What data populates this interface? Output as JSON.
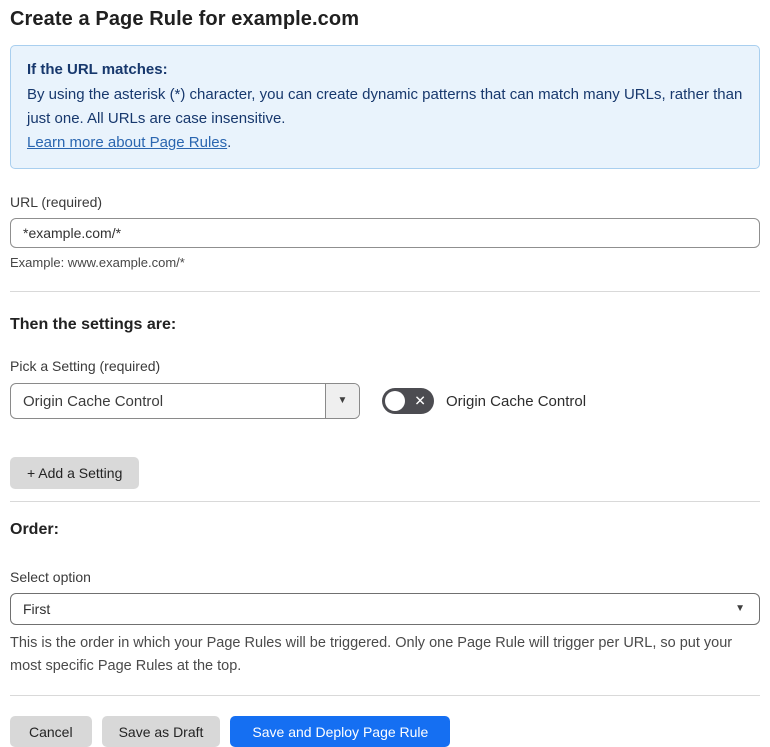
{
  "page": {
    "title": "Create a Page Rule for example.com"
  },
  "info_box": {
    "heading": "If the URL matches:",
    "body": "By using the asterisk (*) character, you can create dynamic patterns that can match many URLs, rather than just one. All URLs are case insensitive.",
    "link_text": "Learn more about Page Rules",
    "link_suffix": "."
  },
  "url_field": {
    "label": "URL (required)",
    "value": "*example.com/*",
    "example": "Example: www.example.com/*"
  },
  "settings_section": {
    "heading": "Then the settings are:",
    "pick_label": "Pick a Setting (required)",
    "selected_setting": "Origin Cache Control",
    "dropdown_arrow": "▼",
    "toggle_state": "off",
    "toggle_off_glyph": "✕",
    "toggle_label": "Origin Cache Control",
    "add_button_label": "+ Add a Setting"
  },
  "order_section": {
    "heading": "Order:",
    "select_label": "Select option",
    "selected_option": "First",
    "dropdown_arrow": "▼",
    "help_text": "This is the order in which your Page Rules will be triggered. Only one Page Rule will trigger per URL, so put your most specific Page Rules at the top."
  },
  "footer": {
    "cancel_label": "Cancel",
    "save_draft_label": "Save as Draft",
    "save_deploy_label": "Save and Deploy Page Rule"
  },
  "colors": {
    "info_background": "#e9f3fc",
    "info_border": "#a9cfef",
    "info_text": "#17386d",
    "link_blue": "#2a66b0",
    "toggle_off": "#4c4c51",
    "button_gray": "#d8d8d8",
    "primary_blue": "#156ff2"
  }
}
